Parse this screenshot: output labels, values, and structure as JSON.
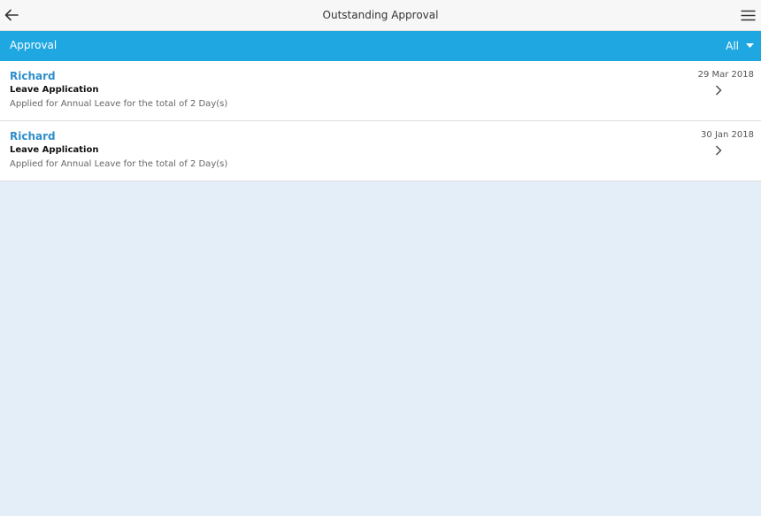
{
  "header": {
    "title": "Outstanding Approval",
    "back_icon": "arrow-left-icon",
    "menu_icon": "hamburger-menu-icon"
  },
  "filter": {
    "label": "Approval",
    "selected": "All",
    "dropdown_icon": "caret-down-icon"
  },
  "approvals": [
    {
      "name": "Richard",
      "type": "Leave Application",
      "description": "Applied for Annual Leave for the total of 2 Day(s)",
      "date": "29 Mar 2018"
    },
    {
      "name": "Richard",
      "type": "Leave Application",
      "description": "Applied for Annual Leave for the total of 2 Day(s)",
      "date": "30 Jan 2018"
    }
  ],
  "colors": {
    "accent": "#1fa7e2",
    "name": "#2e8fcb",
    "background": "#e3eef8"
  }
}
